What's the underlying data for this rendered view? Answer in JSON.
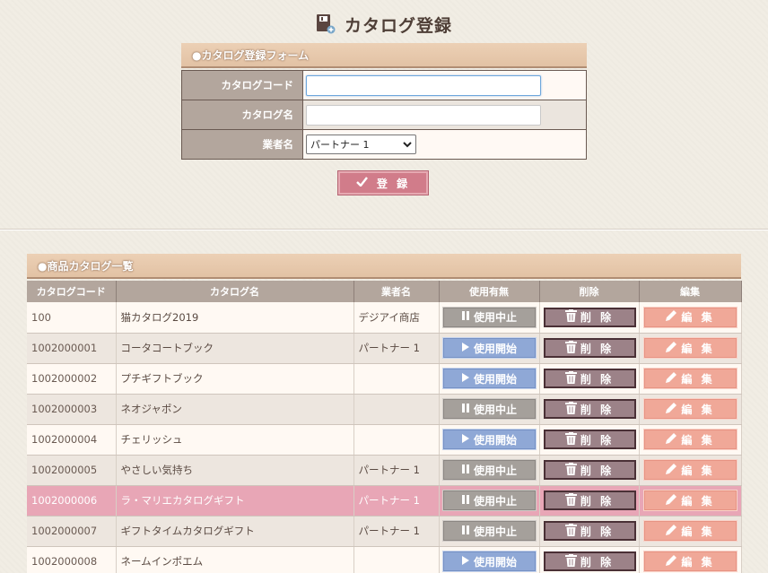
{
  "page": {
    "title": "カタログ登録"
  },
  "form": {
    "section_title": "●カタログ登録フォーム",
    "fields": {
      "code_label": "カタログコード",
      "code_value": "",
      "name_label": "カタログ名",
      "name_value": "",
      "vendor_label": "業者名",
      "vendor_selected": "パートナー 1"
    },
    "submit_label": "登 録"
  },
  "list": {
    "section_title": "●商品カタログ一覧",
    "columns": [
      "カタログコード",
      "カタログ名",
      "業者名",
      "使用有無",
      "削除",
      "編集"
    ],
    "delete_label": "削 除",
    "edit_label": "編 集",
    "rows": [
      {
        "code": "100",
        "name": "猫カタログ2019",
        "vendor": "デジアイ商店",
        "status_label": "使用中止",
        "status_type": "stop"
      },
      {
        "code": "1002000001",
        "name": "コータコートブック",
        "vendor": "パートナー 1",
        "status_label": "使用開始",
        "status_type": "start"
      },
      {
        "code": "1002000002",
        "name": "プチギフトブック",
        "vendor": "",
        "status_label": "使用開始",
        "status_type": "start"
      },
      {
        "code": "1002000003",
        "name": "ネオジャポン",
        "vendor": "",
        "status_label": "使用中止",
        "status_type": "stop"
      },
      {
        "code": "1002000004",
        "name": "チェリッシュ",
        "vendor": "",
        "status_label": "使用開始",
        "status_type": "start"
      },
      {
        "code": "1002000005",
        "name": "やさしい気持ち",
        "vendor": "パートナー 1",
        "status_label": "使用中止",
        "status_type": "stop"
      },
      {
        "code": "1002000006",
        "name": "ラ・マリエカタログギフト",
        "vendor": "パートナー 1",
        "status_label": "使用中止",
        "status_type": "stop"
      },
      {
        "code": "1002000007",
        "name": "ギフトタイムカタログギフト",
        "vendor": "パートナー 1",
        "status_label": "使用中止",
        "status_type": "stop"
      },
      {
        "code": "1002000008",
        "name": "ネームインポエム",
        "vendor": "",
        "status_label": "使用開始",
        "status_type": "start"
      }
    ]
  }
}
